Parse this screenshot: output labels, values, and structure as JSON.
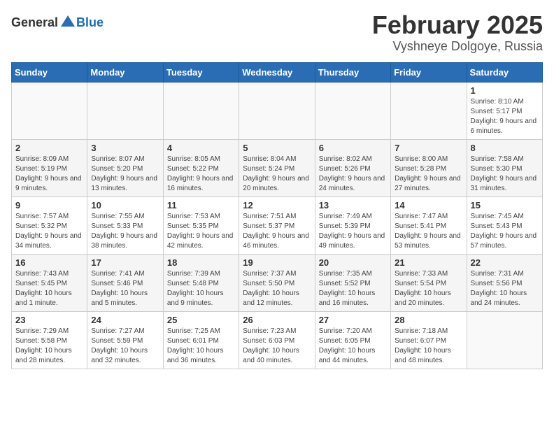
{
  "logo": {
    "general": "General",
    "blue": "Blue"
  },
  "title": {
    "month": "February 2025",
    "location": "Vyshneye Dolgoye, Russia"
  },
  "weekdays": [
    "Sunday",
    "Monday",
    "Tuesday",
    "Wednesday",
    "Thursday",
    "Friday",
    "Saturday"
  ],
  "weeks": [
    [
      {
        "day": "",
        "info": ""
      },
      {
        "day": "",
        "info": ""
      },
      {
        "day": "",
        "info": ""
      },
      {
        "day": "",
        "info": ""
      },
      {
        "day": "",
        "info": ""
      },
      {
        "day": "",
        "info": ""
      },
      {
        "day": "1",
        "info": "Sunrise: 8:10 AM\nSunset: 5:17 PM\nDaylight: 9 hours and 6 minutes."
      }
    ],
    [
      {
        "day": "2",
        "info": "Sunrise: 8:09 AM\nSunset: 5:19 PM\nDaylight: 9 hours and 9 minutes."
      },
      {
        "day": "3",
        "info": "Sunrise: 8:07 AM\nSunset: 5:20 PM\nDaylight: 9 hours and 13 minutes."
      },
      {
        "day": "4",
        "info": "Sunrise: 8:05 AM\nSunset: 5:22 PM\nDaylight: 9 hours and 16 minutes."
      },
      {
        "day": "5",
        "info": "Sunrise: 8:04 AM\nSunset: 5:24 PM\nDaylight: 9 hours and 20 minutes."
      },
      {
        "day": "6",
        "info": "Sunrise: 8:02 AM\nSunset: 5:26 PM\nDaylight: 9 hours and 24 minutes."
      },
      {
        "day": "7",
        "info": "Sunrise: 8:00 AM\nSunset: 5:28 PM\nDaylight: 9 hours and 27 minutes."
      },
      {
        "day": "8",
        "info": "Sunrise: 7:58 AM\nSunset: 5:30 PM\nDaylight: 9 hours and 31 minutes."
      }
    ],
    [
      {
        "day": "9",
        "info": "Sunrise: 7:57 AM\nSunset: 5:32 PM\nDaylight: 9 hours and 34 minutes."
      },
      {
        "day": "10",
        "info": "Sunrise: 7:55 AM\nSunset: 5:33 PM\nDaylight: 9 hours and 38 minutes."
      },
      {
        "day": "11",
        "info": "Sunrise: 7:53 AM\nSunset: 5:35 PM\nDaylight: 9 hours and 42 minutes."
      },
      {
        "day": "12",
        "info": "Sunrise: 7:51 AM\nSunset: 5:37 PM\nDaylight: 9 hours and 46 minutes."
      },
      {
        "day": "13",
        "info": "Sunrise: 7:49 AM\nSunset: 5:39 PM\nDaylight: 9 hours and 49 minutes."
      },
      {
        "day": "14",
        "info": "Sunrise: 7:47 AM\nSunset: 5:41 PM\nDaylight: 9 hours and 53 minutes."
      },
      {
        "day": "15",
        "info": "Sunrise: 7:45 AM\nSunset: 5:43 PM\nDaylight: 9 hours and 57 minutes."
      }
    ],
    [
      {
        "day": "16",
        "info": "Sunrise: 7:43 AM\nSunset: 5:45 PM\nDaylight: 10 hours and 1 minute."
      },
      {
        "day": "17",
        "info": "Sunrise: 7:41 AM\nSunset: 5:46 PM\nDaylight: 10 hours and 5 minutes."
      },
      {
        "day": "18",
        "info": "Sunrise: 7:39 AM\nSunset: 5:48 PM\nDaylight: 10 hours and 9 minutes."
      },
      {
        "day": "19",
        "info": "Sunrise: 7:37 AM\nSunset: 5:50 PM\nDaylight: 10 hours and 12 minutes."
      },
      {
        "day": "20",
        "info": "Sunrise: 7:35 AM\nSunset: 5:52 PM\nDaylight: 10 hours and 16 minutes."
      },
      {
        "day": "21",
        "info": "Sunrise: 7:33 AM\nSunset: 5:54 PM\nDaylight: 10 hours and 20 minutes."
      },
      {
        "day": "22",
        "info": "Sunrise: 7:31 AM\nSunset: 5:56 PM\nDaylight: 10 hours and 24 minutes."
      }
    ],
    [
      {
        "day": "23",
        "info": "Sunrise: 7:29 AM\nSunset: 5:58 PM\nDaylight: 10 hours and 28 minutes."
      },
      {
        "day": "24",
        "info": "Sunrise: 7:27 AM\nSunset: 5:59 PM\nDaylight: 10 hours and 32 minutes."
      },
      {
        "day": "25",
        "info": "Sunrise: 7:25 AM\nSunset: 6:01 PM\nDaylight: 10 hours and 36 minutes."
      },
      {
        "day": "26",
        "info": "Sunrise: 7:23 AM\nSunset: 6:03 PM\nDaylight: 10 hours and 40 minutes."
      },
      {
        "day": "27",
        "info": "Sunrise: 7:20 AM\nSunset: 6:05 PM\nDaylight: 10 hours and 44 minutes."
      },
      {
        "day": "28",
        "info": "Sunrise: 7:18 AM\nSunset: 6:07 PM\nDaylight: 10 hours and 48 minutes."
      },
      {
        "day": "",
        "info": ""
      }
    ]
  ]
}
